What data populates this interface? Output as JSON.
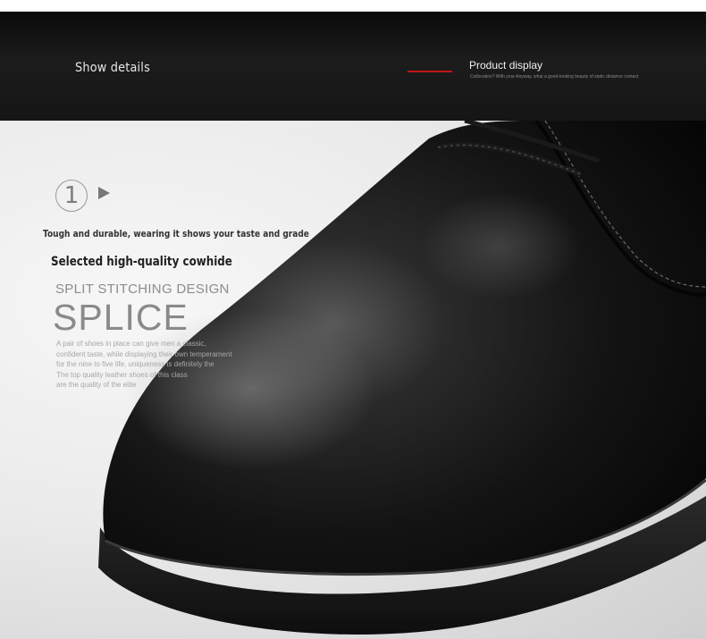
{
  "header": {
    "show_details": "Show details",
    "product_display": "Product display",
    "product_sub": "Collocation? With your Anyway, what a good-looking beauty of static distance contact",
    "accent_color": "#c41616"
  },
  "feature": {
    "number": "1",
    "tagline": "Tough and durable, wearing it shows your taste and grade",
    "selected": "Selected high-quality cowhide",
    "subtitle": "SPLIT STITCHING DESIGN",
    "title": "SPLICE",
    "description": [
      "A pair of shoes in place can give men a classic,",
      "confident taste, while displaying their own temperament",
      "for the nine to five life, uniqueness is definitely the",
      "The top quality leather shoes of this class",
      "are the quality of the elite"
    ]
  }
}
